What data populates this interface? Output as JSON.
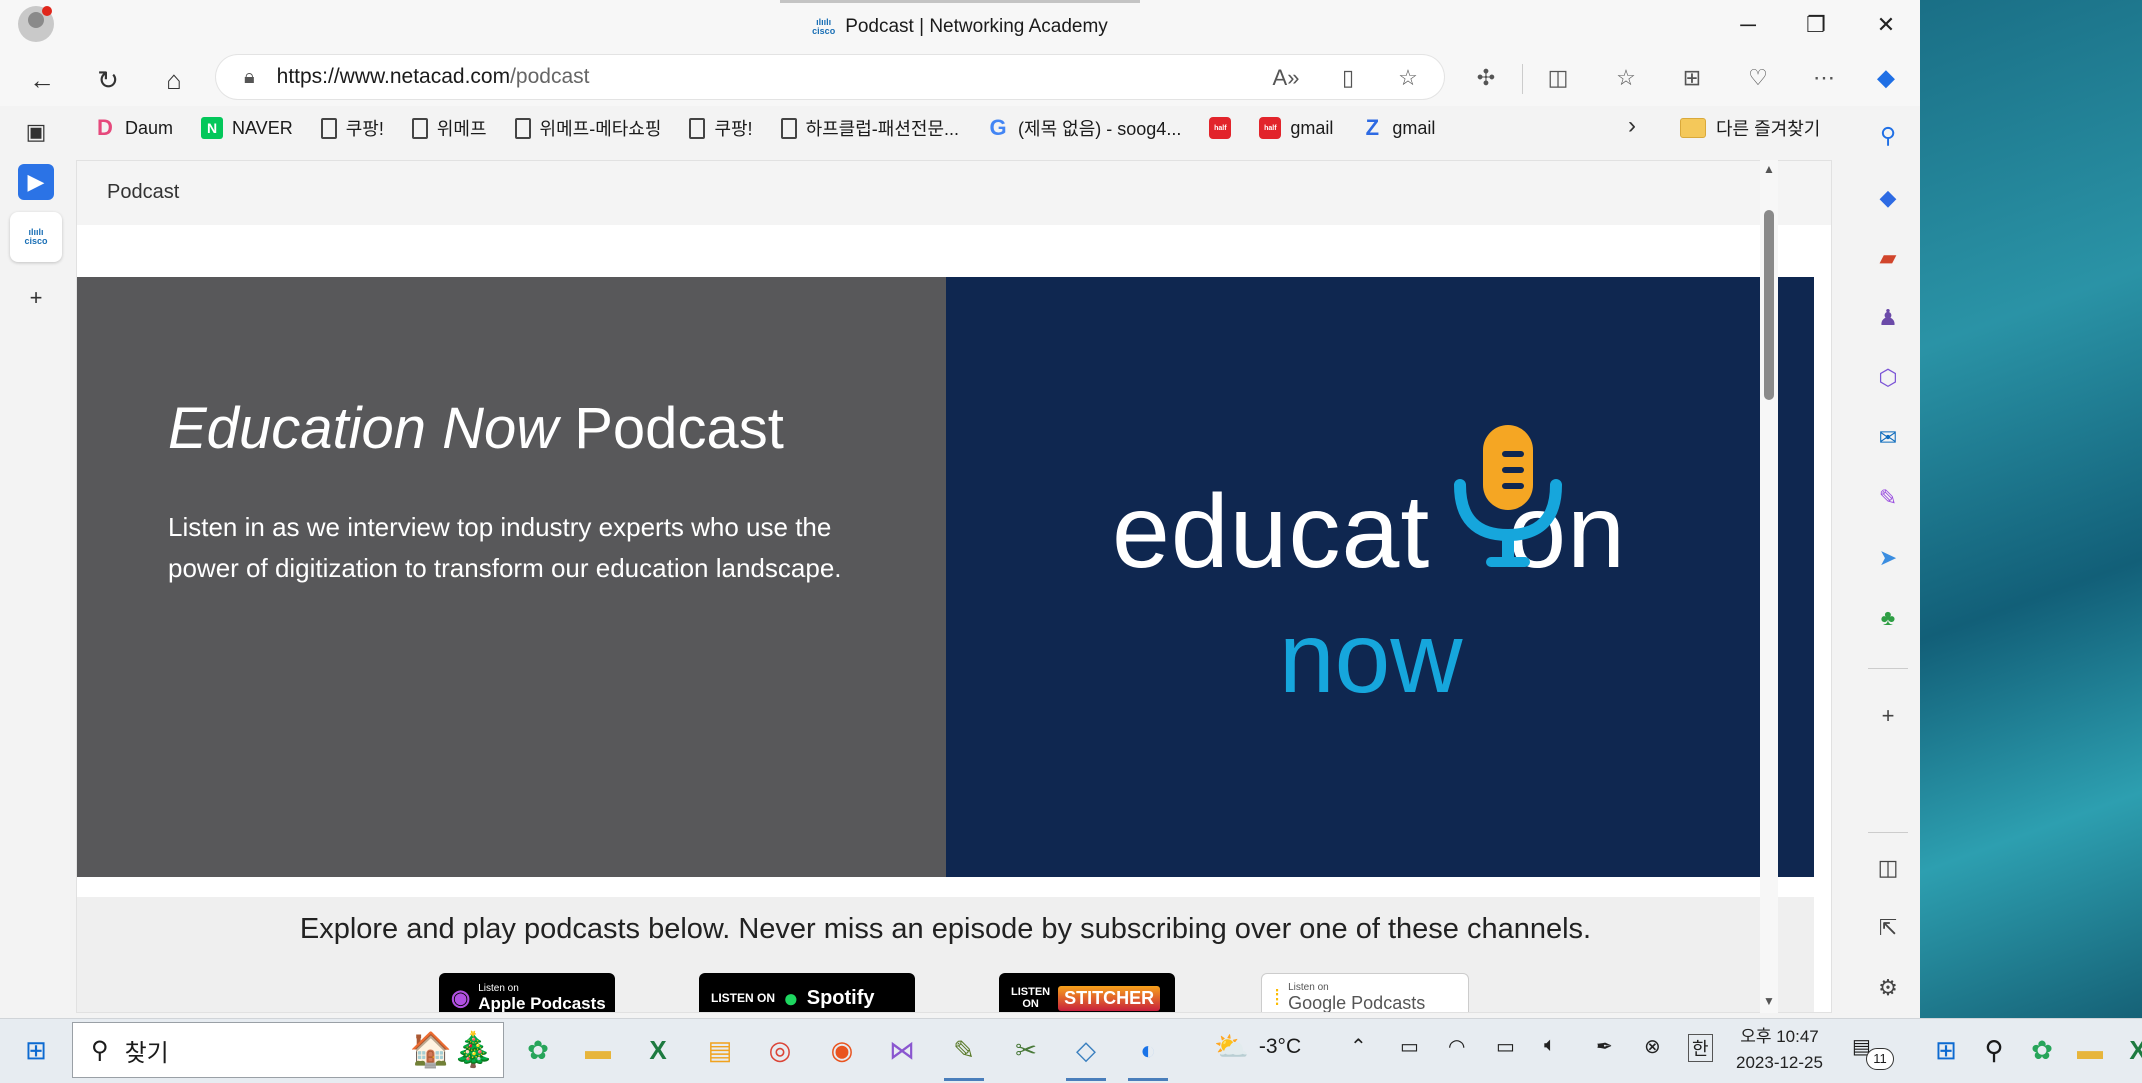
{
  "window": {
    "tab_title": "Podcast | Networking Academy",
    "tab_logo_text": "cisco"
  },
  "address_bar": {
    "url_host": "https://www.netacad.com",
    "url_path": "/podcast"
  },
  "favorites": [
    {
      "label": "Daum",
      "icon": "daum-icon"
    },
    {
      "label": "NAVER",
      "icon": "naver-icon"
    },
    {
      "label": "쿠팡!",
      "icon": "page-icon"
    },
    {
      "label": "위메프",
      "icon": "page-icon"
    },
    {
      "label": "위메프-메타쇼핑",
      "icon": "page-icon"
    },
    {
      "label": "쿠팡!",
      "icon": "page-icon"
    },
    {
      "label": "하프클럽-패션전문...",
      "icon": "page-icon"
    },
    {
      "label": "(제목 없음) - soog4...",
      "icon": "google-icon"
    },
    {
      "label": "",
      "icon": "halfclub-icon"
    },
    {
      "label": "gmail",
      "icon": "halfclub-icon"
    },
    {
      "label": "gmail",
      "icon": "z-icon"
    }
  ],
  "favorites_folder": "다른 즐겨찾기",
  "page": {
    "breadcrumb": "Podcast",
    "hero_title_italic": "Education Now",
    "hero_title_rest": " Podcast",
    "hero_description": "Listen in as we interview top industry experts who use the power of digitization to transform our education landscape.",
    "logo_word_1a": "educat",
    "logo_word_1b": "on",
    "logo_word_2": "now",
    "explore_text": "Explore and play podcasts below. Never miss an episode by subscribing over one of these channels.",
    "badges": {
      "apple_small": "Listen on",
      "apple": "Apple Podcasts",
      "spotify_prefix": "LISTEN ON",
      "spotify": "Spotify",
      "stitcher_prefix_1": "LISTEN",
      "stitcher_prefix_2": "ON",
      "stitcher": "STITCHER",
      "google_small": "Listen on",
      "google": "Google Podcasts"
    }
  },
  "taskbar": {
    "search_placeholder": "찾기",
    "weather_temp": "-3°C",
    "ime": "한",
    "clock_time": "오후 10:47",
    "clock_date": "2023-12-25",
    "notification_count": "11"
  },
  "colors": {
    "hero_left": "#58585a",
    "hero_right": "#0f2750",
    "logo_accent": "#16a6dc",
    "mic": "#f5a623"
  }
}
